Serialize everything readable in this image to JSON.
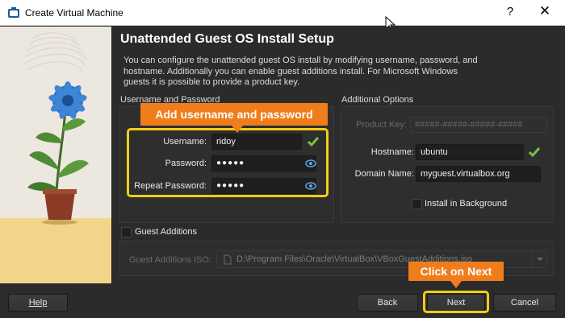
{
  "window": {
    "title": "Create Virtual Machine",
    "help_glyph": "?",
    "close_glyph": "✕",
    "icon": "virtualbox-icon"
  },
  "page": {
    "heading": "Unattended Guest OS Install Setup",
    "description": "You can configure the unattended guest OS install by modifying username, password, and hostname. Additionally you can enable guest additions install. For Microsoft Windows guests it is possible to provide a product key."
  },
  "user_group": {
    "label": "Username and Password",
    "username_label": "Username:",
    "username_value": "ridoy",
    "password_label": "Password:",
    "password_value": "●●●●●",
    "repeat_label": "Repeat Password:",
    "repeat_value": "●●●●●"
  },
  "options_group": {
    "label": "Additional Options",
    "product_key_label": "Product Key:",
    "product_key_placeholder": "#####-#####-#####-#####",
    "hostname_label": "Hostname:",
    "hostname_value": "ubuntu",
    "domain_label": "Domain Name:",
    "domain_value": "myguest.virtualbox.org",
    "install_bg_label": "Install in Background",
    "install_bg_checked": false
  },
  "guest_additions": {
    "label": "Guest Additions",
    "checked": false,
    "iso_label": "Guest Additions ISO:",
    "iso_value": "D:\\Program Files\\Oracle\\VirtualBox\\VBoxGuestAdditions.iso"
  },
  "buttons": {
    "help": "Help",
    "back": "Back",
    "next": "Next",
    "cancel": "Cancel"
  },
  "annotations": {
    "credentials_callout": "Add username and password",
    "next_callout": "Click on Next"
  },
  "colors": {
    "callout": "#f07d1b",
    "highlight": "#f6cc15",
    "valid_check": "#7ac142",
    "eye_icon": "#5aa7e6"
  }
}
